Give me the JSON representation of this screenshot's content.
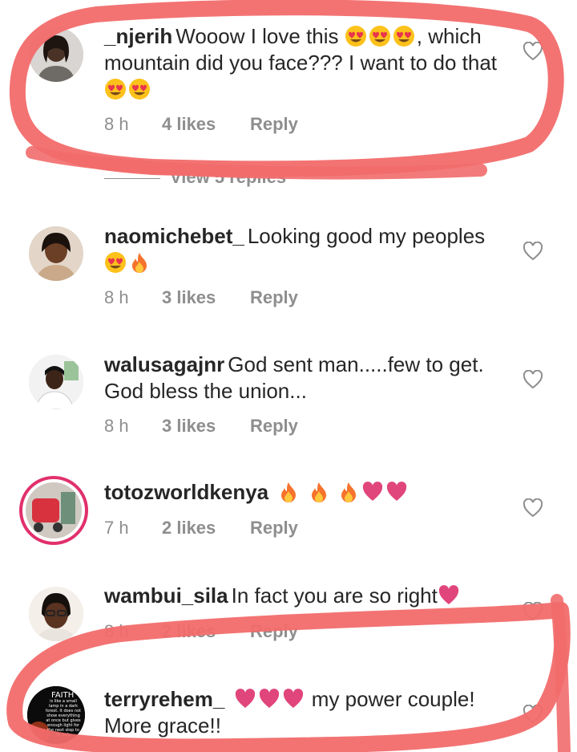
{
  "colors": {
    "highlight": "#f26b6b",
    "heart": "#e0457b",
    "fire": "#f5732c",
    "meta": "#8e8e8e",
    "text": "#262626",
    "story_ring": "#e1306c"
  },
  "comments": [
    {
      "user": "_njerih",
      "text": "Wooow I love this",
      "text2": ", which mountain did you face??? I want to do that",
      "time": "8 h",
      "likes": "4 likes",
      "reply": "Reply"
    },
    {
      "user": "naomichebet_",
      "text": "Looking good my peoples",
      "time": "8 h",
      "likes": "3 likes",
      "reply": "Reply"
    },
    {
      "user": "walusagajnr",
      "text": "God sent man.....few to get. God bless the union...",
      "time": "8 h",
      "likes": "3 likes",
      "reply": "Reply"
    },
    {
      "user": "totozworldkenya",
      "text": "",
      "time": "7 h",
      "likes": "2 likes",
      "reply": "Reply"
    },
    {
      "user": "wambui_sila",
      "text": "In fact you are so right",
      "time": "8 h",
      "likes": "2 likes",
      "reply": "Reply"
    },
    {
      "user": "terryrehem_",
      "text": "my power couple! More grace!!",
      "time": "",
      "likes": "",
      "reply": ""
    }
  ],
  "view_replies": "View 5 replies",
  "avatar_text": {
    "faith_title": "FAITH",
    "faith_body": "is like a small lamp in a dark forest. It does not show everything at once but gives enough light for the next step to be safe"
  },
  "icons": [
    "heart-outline-icon",
    "heart-eyes-emoji",
    "fire-emoji",
    "red-heart-emoji"
  ]
}
